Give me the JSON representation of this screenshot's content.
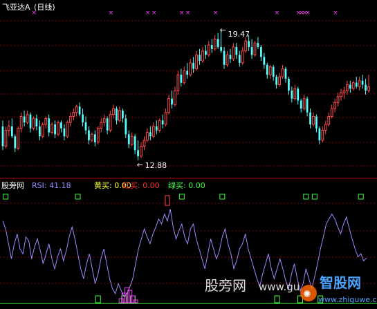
{
  "stock": {
    "name": "飞亚达A",
    "period": "(日线)",
    "high_label": "19.47",
    "low_label": "12.88"
  },
  "indicator": {
    "name": "股旁网",
    "rsi_label": "RSI: 41.18",
    "yellow_buy_label": "黄买: 0.00",
    "red_buy_label": "红买: 0.00",
    "green_buy_label": "绿买: 0.00"
  },
  "watermark": {
    "site1": "股旁网",
    "url1": "www.gu",
    "site2": "智股网",
    "url2": "www.zhiguwe.com"
  },
  "colors": {
    "up": "#ff4b4b",
    "down": "#54ffff",
    "rsi": "#9b8cff",
    "magenta": "#ff40ff",
    "green": "#40ff40",
    "grid": "#8b0000",
    "header_white": "#ffffff",
    "label_yellow": "#ffff40",
    "label_red": "#ff3030",
    "label_green": "#40ff40",
    "rsi_text": "#9b8cff"
  },
  "chart_data": [
    {
      "type": "candlestick",
      "title": "飞亚达A (日线)",
      "ylim": [
        12.4,
        20.2
      ],
      "annotations": [
        {
          "text": "19.47",
          "value": 19.47,
          "index": 71
        },
        {
          "text": "12.88",
          "value": 12.88,
          "index": 44
        }
      ],
      "marker_indices": [
        10,
        35,
        47,
        49,
        58,
        60,
        69,
        89,
        96,
        97,
        98,
        99,
        108,
        131
      ],
      "candles": [
        {
          "o": 14.6,
          "h": 14.9,
          "l": 13.4,
          "c": 13.6
        },
        {
          "o": 13.6,
          "h": 14.6,
          "l": 13.5,
          "c": 14.4
        },
        {
          "o": 14.4,
          "h": 14.9,
          "l": 14.1,
          "c": 14.6
        },
        {
          "o": 14.6,
          "h": 15.0,
          "l": 14.0,
          "c": 14.1
        },
        {
          "o": 14.1,
          "h": 14.2,
          "l": 13.3,
          "c": 13.5
        },
        {
          "o": 13.5,
          "h": 14.6,
          "l": 13.4,
          "c": 14.5
        },
        {
          "o": 14.5,
          "h": 15.3,
          "l": 14.3,
          "c": 15.1
        },
        {
          "o": 15.1,
          "h": 15.4,
          "l": 14.6,
          "c": 14.8
        },
        {
          "o": 14.8,
          "h": 15.4,
          "l": 14.7,
          "c": 15.2
        },
        {
          "o": 15.2,
          "h": 15.3,
          "l": 14.3,
          "c": 14.5
        },
        {
          "o": 14.5,
          "h": 15.1,
          "l": 14.4,
          "c": 15.0
        },
        {
          "o": 15.0,
          "h": 15.2,
          "l": 14.4,
          "c": 14.6
        },
        {
          "o": 14.6,
          "h": 14.9,
          "l": 13.9,
          "c": 14.1
        },
        {
          "o": 14.1,
          "h": 14.8,
          "l": 14.0,
          "c": 14.7
        },
        {
          "o": 14.7,
          "h": 15.1,
          "l": 14.5,
          "c": 15.0
        },
        {
          "o": 15.0,
          "h": 15.2,
          "l": 14.1,
          "c": 14.3
        },
        {
          "o": 14.3,
          "h": 14.8,
          "l": 14.2,
          "c": 14.7
        },
        {
          "o": 14.7,
          "h": 14.9,
          "l": 14.0,
          "c": 14.2
        },
        {
          "o": 14.2,
          "h": 14.9,
          "l": 14.1,
          "c": 14.8
        },
        {
          "o": 14.8,
          "h": 14.9,
          "l": 14.3,
          "c": 14.5
        },
        {
          "o": 14.5,
          "h": 14.7,
          "l": 13.9,
          "c": 14.1
        },
        {
          "o": 14.1,
          "h": 14.9,
          "l": 14.0,
          "c": 14.8
        },
        {
          "o": 14.8,
          "h": 15.3,
          "l": 14.6,
          "c": 15.1
        },
        {
          "o": 15.1,
          "h": 15.5,
          "l": 14.9,
          "c": 15.3
        },
        {
          "o": 15.3,
          "h": 15.7,
          "l": 15.1,
          "c": 15.6
        },
        {
          "o": 15.6,
          "h": 15.8,
          "l": 15.1,
          "c": 15.2
        },
        {
          "o": 15.2,
          "h": 15.5,
          "l": 14.6,
          "c": 14.8
        },
        {
          "o": 14.8,
          "h": 15.1,
          "l": 14.2,
          "c": 14.4
        },
        {
          "o": 14.4,
          "h": 14.6,
          "l": 13.7,
          "c": 13.9
        },
        {
          "o": 13.9,
          "h": 14.3,
          "l": 13.8,
          "c": 14.2
        },
        {
          "o": 14.2,
          "h": 14.4,
          "l": 13.6,
          "c": 13.8
        },
        {
          "o": 13.8,
          "h": 14.6,
          "l": 13.7,
          "c": 14.5
        },
        {
          "o": 14.5,
          "h": 15.0,
          "l": 14.3,
          "c": 14.8
        },
        {
          "o": 14.8,
          "h": 15.2,
          "l": 14.6,
          "c": 15.0
        },
        {
          "o": 15.0,
          "h": 15.1,
          "l": 14.2,
          "c": 14.4
        },
        {
          "o": 14.4,
          "h": 15.4,
          "l": 14.3,
          "c": 15.2
        },
        {
          "o": 15.2,
          "h": 15.7,
          "l": 15.0,
          "c": 15.5
        },
        {
          "o": 15.5,
          "h": 15.6,
          "l": 14.7,
          "c": 14.9
        },
        {
          "o": 14.9,
          "h": 15.6,
          "l": 14.8,
          "c": 15.4
        },
        {
          "o": 15.4,
          "h": 15.5,
          "l": 14.8,
          "c": 15.0
        },
        {
          "o": 15.0,
          "h": 15.2,
          "l": 14.0,
          "c": 14.2
        },
        {
          "o": 14.2,
          "h": 14.4,
          "l": 13.5,
          "c": 13.7
        },
        {
          "o": 13.7,
          "h": 14.3,
          "l": 13.6,
          "c": 14.1
        },
        {
          "o": 14.1,
          "h": 14.2,
          "l": 13.2,
          "c": 13.4
        },
        {
          "o": 13.4,
          "h": 13.9,
          "l": 12.88,
          "c": 13.1
        },
        {
          "o": 13.1,
          "h": 13.8,
          "l": 13.0,
          "c": 13.6
        },
        {
          "o": 13.6,
          "h": 14.1,
          "l": 13.4,
          "c": 13.9
        },
        {
          "o": 13.9,
          "h": 14.5,
          "l": 13.8,
          "c": 14.3
        },
        {
          "o": 14.3,
          "h": 14.6,
          "l": 13.9,
          "c": 14.1
        },
        {
          "o": 14.1,
          "h": 14.8,
          "l": 14.0,
          "c": 14.6
        },
        {
          "o": 14.6,
          "h": 14.9,
          "l": 14.2,
          "c": 14.4
        },
        {
          "o": 14.4,
          "h": 15.0,
          "l": 14.3,
          "c": 14.9
        },
        {
          "o": 14.9,
          "h": 15.2,
          "l": 14.5,
          "c": 14.7
        },
        {
          "o": 14.7,
          "h": 15.5,
          "l": 14.6,
          "c": 15.3
        },
        {
          "o": 15.3,
          "h": 16.2,
          "l": 15.2,
          "c": 16.0
        },
        {
          "o": 16.0,
          "h": 16.4,
          "l": 15.5,
          "c": 15.7
        },
        {
          "o": 15.7,
          "h": 16.6,
          "l": 15.6,
          "c": 16.4
        },
        {
          "o": 16.4,
          "h": 17.4,
          "l": 16.2,
          "c": 17.2
        },
        {
          "o": 17.2,
          "h": 17.5,
          "l": 16.6,
          "c": 16.8
        },
        {
          "o": 16.8,
          "h": 17.6,
          "l": 16.7,
          "c": 17.4
        },
        {
          "o": 17.4,
          "h": 17.8,
          "l": 17.0,
          "c": 17.2
        },
        {
          "o": 17.2,
          "h": 18.0,
          "l": 17.1,
          "c": 17.8
        },
        {
          "o": 17.8,
          "h": 18.1,
          "l": 17.3,
          "c": 17.5
        },
        {
          "o": 17.5,
          "h": 18.4,
          "l": 17.4,
          "c": 18.2
        },
        {
          "o": 18.2,
          "h": 18.5,
          "l": 17.7,
          "c": 17.9
        },
        {
          "o": 17.9,
          "h": 18.6,
          "l": 17.8,
          "c": 18.4
        },
        {
          "o": 18.4,
          "h": 18.7,
          "l": 18.0,
          "c": 18.2
        },
        {
          "o": 18.2,
          "h": 18.9,
          "l": 18.1,
          "c": 18.7
        },
        {
          "o": 18.7,
          "h": 19.0,
          "l": 18.3,
          "c": 18.5
        },
        {
          "o": 18.5,
          "h": 19.2,
          "l": 18.4,
          "c": 19.0
        },
        {
          "o": 19.0,
          "h": 19.3,
          "l": 18.5,
          "c": 18.6
        },
        {
          "o": 18.6,
          "h": 19.47,
          "l": 18.3,
          "c": 18.4
        },
        {
          "o": 18.4,
          "h": 18.6,
          "l": 17.5,
          "c": 17.7
        },
        {
          "o": 17.7,
          "h": 18.4,
          "l": 17.6,
          "c": 18.2
        },
        {
          "o": 18.2,
          "h": 18.5,
          "l": 17.8,
          "c": 18.0
        },
        {
          "o": 18.0,
          "h": 18.8,
          "l": 17.9,
          "c": 18.6
        },
        {
          "o": 18.6,
          "h": 18.8,
          "l": 18.0,
          "c": 18.2
        },
        {
          "o": 18.2,
          "h": 18.4,
          "l": 17.6,
          "c": 17.8
        },
        {
          "o": 17.8,
          "h": 18.6,
          "l": 17.7,
          "c": 18.4
        },
        {
          "o": 18.4,
          "h": 19.1,
          "l": 18.3,
          "c": 18.9
        },
        {
          "o": 18.9,
          "h": 19.2,
          "l": 18.4,
          "c": 18.6
        },
        {
          "o": 18.6,
          "h": 19.0,
          "l": 18.0,
          "c": 18.2
        },
        {
          "o": 18.2,
          "h": 18.9,
          "l": 18.1,
          "c": 18.8
        },
        {
          "o": 18.8,
          "h": 19.1,
          "l": 18.5,
          "c": 18.6
        },
        {
          "o": 18.6,
          "h": 18.7,
          "l": 17.9,
          "c": 18.1
        },
        {
          "o": 18.1,
          "h": 18.3,
          "l": 17.5,
          "c": 17.7
        },
        {
          "o": 17.7,
          "h": 17.8,
          "l": 17.0,
          "c": 17.2
        },
        {
          "o": 17.2,
          "h": 17.7,
          "l": 17.0,
          "c": 17.6
        },
        {
          "o": 17.6,
          "h": 17.7,
          "l": 16.9,
          "c": 17.1
        },
        {
          "o": 17.1,
          "h": 17.2,
          "l": 16.5,
          "c": 16.7
        },
        {
          "o": 16.7,
          "h": 17.3,
          "l": 16.6,
          "c": 17.1
        },
        {
          "o": 17.1,
          "h": 17.7,
          "l": 17.0,
          "c": 17.5
        },
        {
          "o": 17.5,
          "h": 17.6,
          "l": 16.8,
          "c": 17.0
        },
        {
          "o": 17.0,
          "h": 17.1,
          "l": 16.2,
          "c": 16.4
        },
        {
          "o": 16.4,
          "h": 16.6,
          "l": 15.8,
          "c": 16.0
        },
        {
          "o": 16.0,
          "h": 16.7,
          "l": 15.9,
          "c": 16.5
        },
        {
          "o": 16.5,
          "h": 16.6,
          "l": 15.7,
          "c": 15.9
        },
        {
          "o": 15.9,
          "h": 16.0,
          "l": 15.3,
          "c": 15.5
        },
        {
          "o": 15.5,
          "h": 16.2,
          "l": 15.4,
          "c": 16.0
        },
        {
          "o": 16.0,
          "h": 16.1,
          "l": 15.1,
          "c": 15.3
        },
        {
          "o": 15.3,
          "h": 15.5,
          "l": 14.5,
          "c": 14.7
        },
        {
          "o": 14.7,
          "h": 15.3,
          "l": 14.6,
          "c": 15.1
        },
        {
          "o": 15.1,
          "h": 15.2,
          "l": 14.3,
          "c": 14.5
        },
        {
          "o": 14.5,
          "h": 14.6,
          "l": 13.7,
          "c": 13.9
        },
        {
          "o": 13.9,
          "h": 14.6,
          "l": 13.8,
          "c": 14.4
        },
        {
          "o": 14.4,
          "h": 14.9,
          "l": 14.2,
          "c": 14.7
        },
        {
          "o": 14.7,
          "h": 15.3,
          "l": 14.6,
          "c": 15.1
        },
        {
          "o": 15.1,
          "h": 15.7,
          "l": 15.0,
          "c": 15.5
        },
        {
          "o": 15.5,
          "h": 16.0,
          "l": 15.3,
          "c": 15.8
        },
        {
          "o": 15.8,
          "h": 16.3,
          "l": 15.6,
          "c": 16.1
        },
        {
          "o": 16.1,
          "h": 16.5,
          "l": 15.9,
          "c": 16.3
        },
        {
          "o": 16.3,
          "h": 16.6,
          "l": 16.0,
          "c": 16.4
        },
        {
          "o": 16.4,
          "h": 16.9,
          "l": 16.2,
          "c": 16.7
        },
        {
          "o": 16.7,
          "h": 16.9,
          "l": 16.3,
          "c": 16.5
        },
        {
          "o": 16.5,
          "h": 16.9,
          "l": 16.4,
          "c": 16.8
        },
        {
          "o": 16.8,
          "h": 17.1,
          "l": 16.5,
          "c": 16.6
        },
        {
          "o": 16.6,
          "h": 17.1,
          "l": 16.4,
          "c": 16.9
        },
        {
          "o": 16.9,
          "h": 17.2,
          "l": 16.5,
          "c": 16.7
        },
        {
          "o": 16.7,
          "h": 17.0,
          "l": 16.2,
          "c": 16.4
        },
        {
          "o": 16.4,
          "h": 17.2,
          "l": 16.3,
          "c": 16.6
        }
      ]
    },
    {
      "type": "line",
      "title": "RSI: 41.18",
      "ylim": [
        0,
        100
      ],
      "series": [
        {
          "name": "RSI",
          "values": [
            78,
            70,
            55,
            40,
            55,
            65,
            50,
            45,
            62,
            58,
            40,
            52,
            60,
            48,
            35,
            45,
            55,
            40,
            30,
            42,
            50,
            38,
            48,
            62,
            72,
            60,
            45,
            30,
            20,
            35,
            45,
            30,
            15,
            25,
            40,
            50,
            35,
            20,
            10,
            5,
            15,
            8,
            2,
            5,
            12,
            20,
            35,
            50,
            60,
            70,
            62,
            55,
            65,
            72,
            80,
            75,
            85,
            78,
            90,
            72,
            60,
            68,
            75,
            62,
            55,
            70,
            75,
            60,
            50,
            40,
            30,
            45,
            60,
            50,
            40,
            48,
            62,
            70,
            55,
            45,
            30,
            38,
            50,
            55,
            65,
            50,
            40,
            30,
            20,
            12,
            25,
            35,
            45,
            30,
            20,
            30,
            40,
            30,
            18,
            10,
            25,
            35,
            20,
            8,
            15,
            30,
            20,
            10,
            22,
            35,
            50,
            62,
            75,
            80,
            85,
            80,
            72,
            65,
            75,
            82,
            70,
            60,
            50,
            42,
            45,
            38,
            41
          ]
        }
      ],
      "marker_rows": {
        "green_top_indices": [
          1,
          26,
          62,
          76,
          105,
          108,
          124
        ],
        "green_bottom_indices": [
          33,
          42,
          45,
          95,
          103,
          110
        ],
        "red_top_indices": [
          57
        ],
        "magenta_bottom_indices": [
          41,
          42,
          43,
          44,
          45,
          46
        ]
      }
    }
  ]
}
